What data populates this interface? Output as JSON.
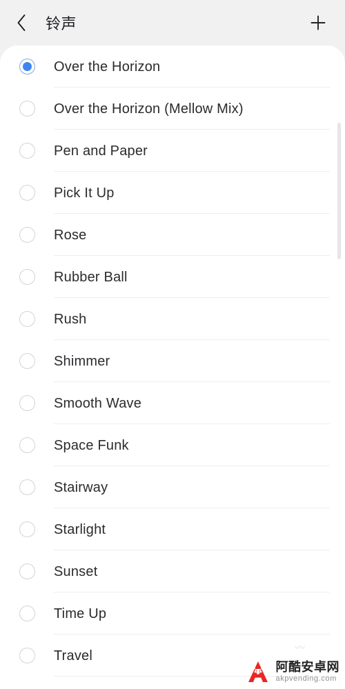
{
  "header": {
    "back_icon": "chevron-left-icon",
    "title": "铃声",
    "add_icon": "plus-icon"
  },
  "list": {
    "selected_index": 0,
    "items": [
      {
        "label": "Over the Horizon",
        "selected": true
      },
      {
        "label": "Over the Horizon (Mellow Mix)",
        "selected": false
      },
      {
        "label": "Pen and Paper",
        "selected": false
      },
      {
        "label": "Pick It Up",
        "selected": false
      },
      {
        "label": "Rose",
        "selected": false
      },
      {
        "label": "Rubber Ball",
        "selected": false
      },
      {
        "label": "Rush",
        "selected": false
      },
      {
        "label": "Shimmer",
        "selected": false
      },
      {
        "label": "Smooth Wave",
        "selected": false
      },
      {
        "label": "Space Funk",
        "selected": false
      },
      {
        "label": "Stairway",
        "selected": false
      },
      {
        "label": "Starlight",
        "selected": false
      },
      {
        "label": "Sunset",
        "selected": false
      },
      {
        "label": "Time Up",
        "selected": false
      },
      {
        "label": "Travel",
        "selected": false
      }
    ]
  },
  "scrollbar": {
    "visible": true
  },
  "watermark": {
    "logo_icon": "android-a-logo-icon",
    "cn_text": "阿酷安卓网",
    "en_text": "akpvending.com"
  },
  "colors": {
    "accent": "#3d86f0",
    "accent_ring": "#7aa9e8",
    "page_background": "#f1f1f2",
    "card_background": "#ffffff",
    "text_primary": "#2b2b2f",
    "divider": "#eeeef0",
    "radio_border": "#d3d3d6",
    "watermark_red": "#e8201c"
  }
}
